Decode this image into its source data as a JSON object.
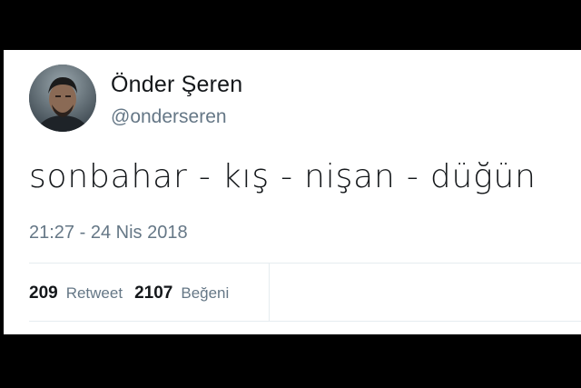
{
  "tweet": {
    "author_name": "Önder Şeren",
    "author_handle": "@onderseren",
    "text": "sonbahar - kış - nişan - düğün",
    "timestamp": "21:27 - 24 Nis 2018",
    "stats": {
      "retweet_count": "209",
      "retweet_label": "Retweet",
      "like_count": "2107",
      "like_label": "Beğeni"
    }
  },
  "colors": {
    "text_primary": "#14171a",
    "text_secondary": "#657786",
    "divider": "#e6ecf0",
    "background_frame": "#000000",
    "card_background": "#ffffff"
  },
  "icons": {
    "avatar": "profile-photo"
  }
}
